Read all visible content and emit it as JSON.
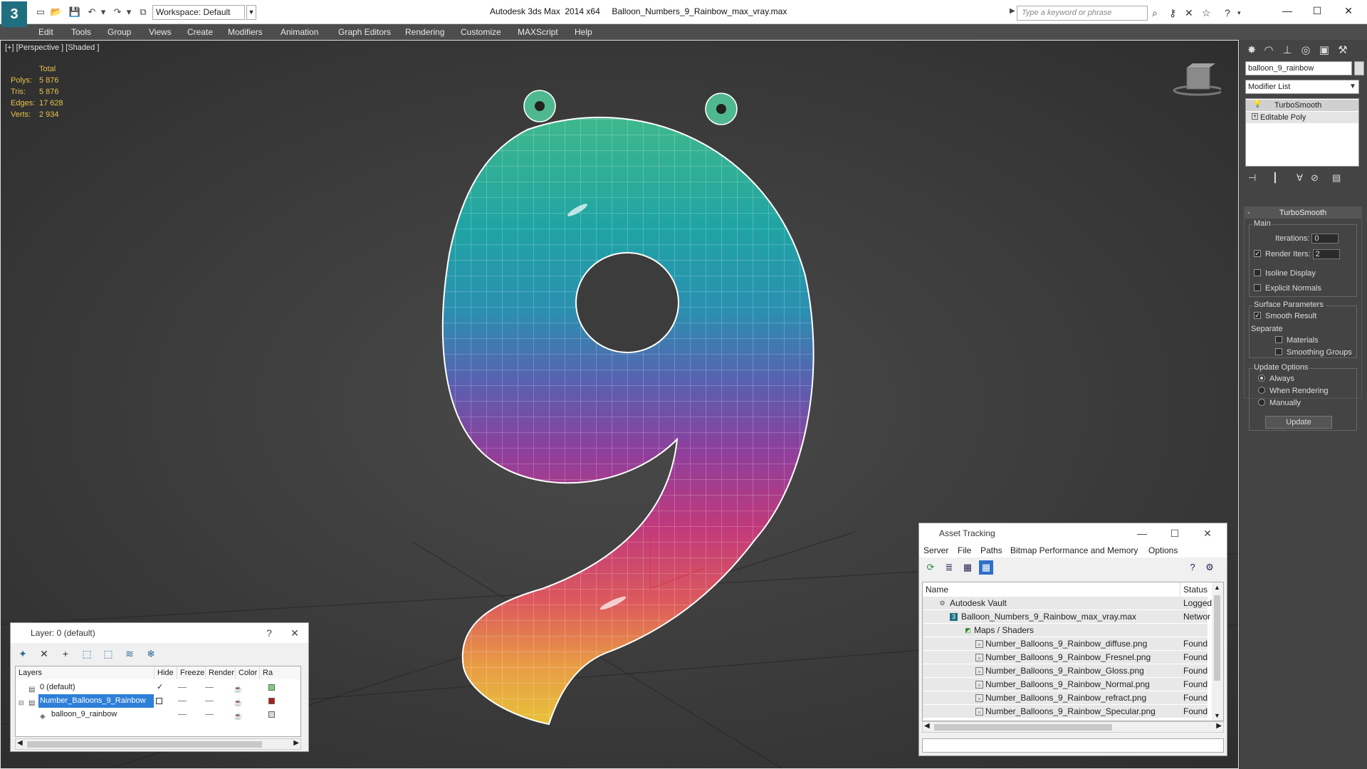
{
  "titlebar": {
    "app_title": "Autodesk 3ds Max  2014 x64     Balloon_Numbers_9_Rainbow_max_vray.max",
    "workspace": "Workspace: Default",
    "search_placeholder": "Type a keyword or phrase"
  },
  "menubar": {
    "items": [
      "Edit",
      "Tools",
      "Group",
      "Views",
      "Create",
      "Modifiers",
      "Animation",
      "Graph Editors",
      "Rendering",
      "Customize",
      "MAXScript",
      "Help"
    ]
  },
  "viewport": {
    "label": "[+] [Perspective ] [Shaded ]",
    "stats": {
      "header": "Total",
      "rows": [
        {
          "label": "Polys:",
          "value": "5 876"
        },
        {
          "label": "Tris:",
          "value": "5 876"
        },
        {
          "label": "Edges:",
          "value": "17 628"
        },
        {
          "label": "Verts:",
          "value": "2 934"
        }
      ]
    }
  },
  "command_panel": {
    "object_name": "balloon_9_rainbow",
    "modifier_list": "Modifier List",
    "stack": [
      "TurboSmooth",
      "Editable Poly"
    ],
    "rollout": {
      "title": "TurboSmooth",
      "main_group": "Main",
      "iterations_label": "Iterations:",
      "iterations_value": "0",
      "render_iters_label": "Render Iters:",
      "render_iters_value": "2",
      "isoline": "Isoline Display",
      "explicit_normals": "Explicit Normals",
      "surface_group": "Surface Parameters",
      "smooth_result": "Smooth Result",
      "separate": "Separate",
      "materials": "Materials",
      "smoothing_groups": "Smoothing Groups",
      "update_group": "Update Options",
      "always": "Always",
      "when_rendering": "When Rendering",
      "manually": "Manually",
      "update_button": "Update"
    }
  },
  "layer_window": {
    "title": "Layer: 0 (default)",
    "help": "?",
    "columns": [
      "Layers",
      "Hide",
      "Freeze",
      "Render",
      "Color",
      "Ra"
    ],
    "rows": [
      {
        "name": "0 (default)",
        "color": "#7ed07e"
      },
      {
        "name": "Number_Balloons_9_Rainbow",
        "color": "#b01c1c"
      },
      {
        "name": "balloon_9_rainbow",
        "color": "#d8d8d8"
      }
    ]
  },
  "asset_window": {
    "title": "Asset Tracking",
    "menu": [
      "Server",
      "File",
      "Paths",
      "Bitmap Performance and Memory",
      "Options"
    ],
    "columns": [
      "Name",
      "Status"
    ],
    "rows": [
      {
        "name": "Autodesk Vault",
        "status": "Logged"
      },
      {
        "name": "Balloon_Numbers_9_Rainbow_max_vray.max",
        "status": "Networ"
      },
      {
        "name": "Maps / Shaders",
        "status": ""
      },
      {
        "name": "Number_Balloons_9_Rainbow_diffuse.png",
        "status": "Found"
      },
      {
        "name": "Number_Balloons_9_Rainbow_Fresnel.png",
        "status": "Found"
      },
      {
        "name": "Number_Balloons_9_Rainbow_Gloss.png",
        "status": "Found"
      },
      {
        "name": "Number_Balloons_9_Rainbow_Normal.png",
        "status": "Found"
      },
      {
        "name": "Number_Balloons_9_Rainbow_refract.png",
        "status": "Found"
      },
      {
        "name": "Number_Balloons_9_Rainbow_Specular.png",
        "status": "Found"
      }
    ]
  },
  "colors": {
    "accent": "#2b6a95",
    "stats": "#e6c24a",
    "viewport_border": "#e0e0e0"
  }
}
